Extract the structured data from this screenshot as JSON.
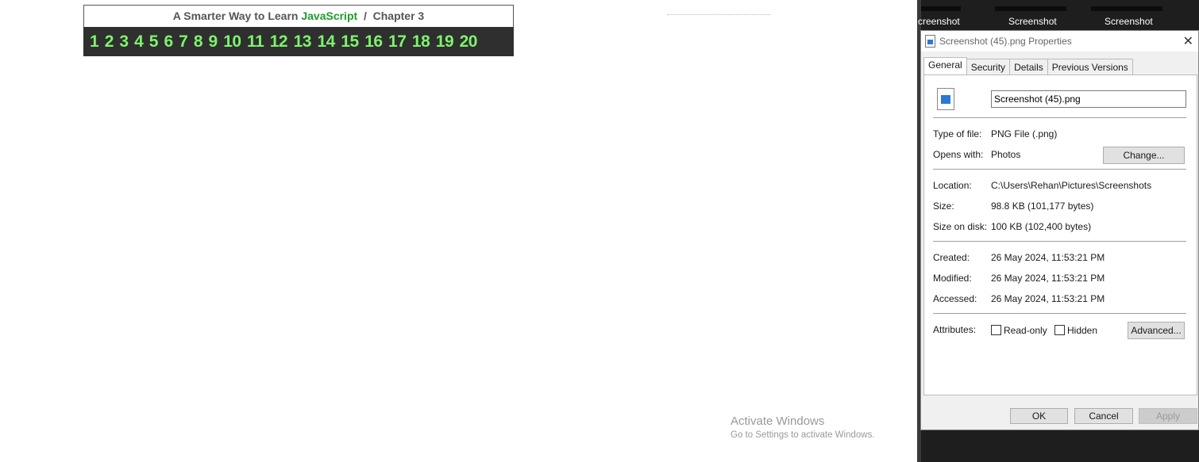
{
  "page": {
    "header_prefix": "A Smarter Way to Learn",
    "header_highlight": "JavaScript",
    "header_sep": "/",
    "header_chapter": "Chapter 3",
    "chapters": [
      "1",
      "2",
      "3",
      "4",
      "5",
      "6",
      "7",
      "8",
      "9",
      "10",
      "11",
      "12",
      "13",
      "14",
      "15",
      "16",
      "17",
      "18",
      "19",
      "20"
    ]
  },
  "watermark": {
    "line1": "Activate Windows",
    "line2": "Go to Settings to activate Windows."
  },
  "thumbnails": [
    "creenshot",
    "Screenshot",
    "Screenshot"
  ],
  "dialog": {
    "title": "Screenshot (45).png Properties",
    "tabs": [
      "General",
      "Security",
      "Details",
      "Previous Versions"
    ],
    "filename": "Screenshot (45).png",
    "type_label": "Type of file:",
    "type_value": "PNG File (.png)",
    "opens_label": "Opens with:",
    "opens_value": "Photos",
    "change_button": "Change...",
    "location_label": "Location:",
    "location_value": "C:\\Users\\Rehan\\Pictures\\Screenshots",
    "size_label": "Size:",
    "size_value": "98.8 KB (101,177 bytes)",
    "disk_label": "Size on disk:",
    "disk_value": "100 KB (102,400 bytes)",
    "created_label": "Created:",
    "created_value": "26 May 2024, 11:53:21 PM",
    "modified_label": "Modified:",
    "modified_value": "26 May 2024, 11:53:21 PM",
    "accessed_label": "Accessed:",
    "accessed_value": "26 May 2024, 11:53:21 PM",
    "attributes_label": "Attributes:",
    "readonly_label": "Read-only",
    "hidden_label": "Hidden",
    "advanced_button": "Advanced...",
    "ok_button": "OK",
    "cancel_button": "Cancel",
    "apply_button": "Apply"
  }
}
